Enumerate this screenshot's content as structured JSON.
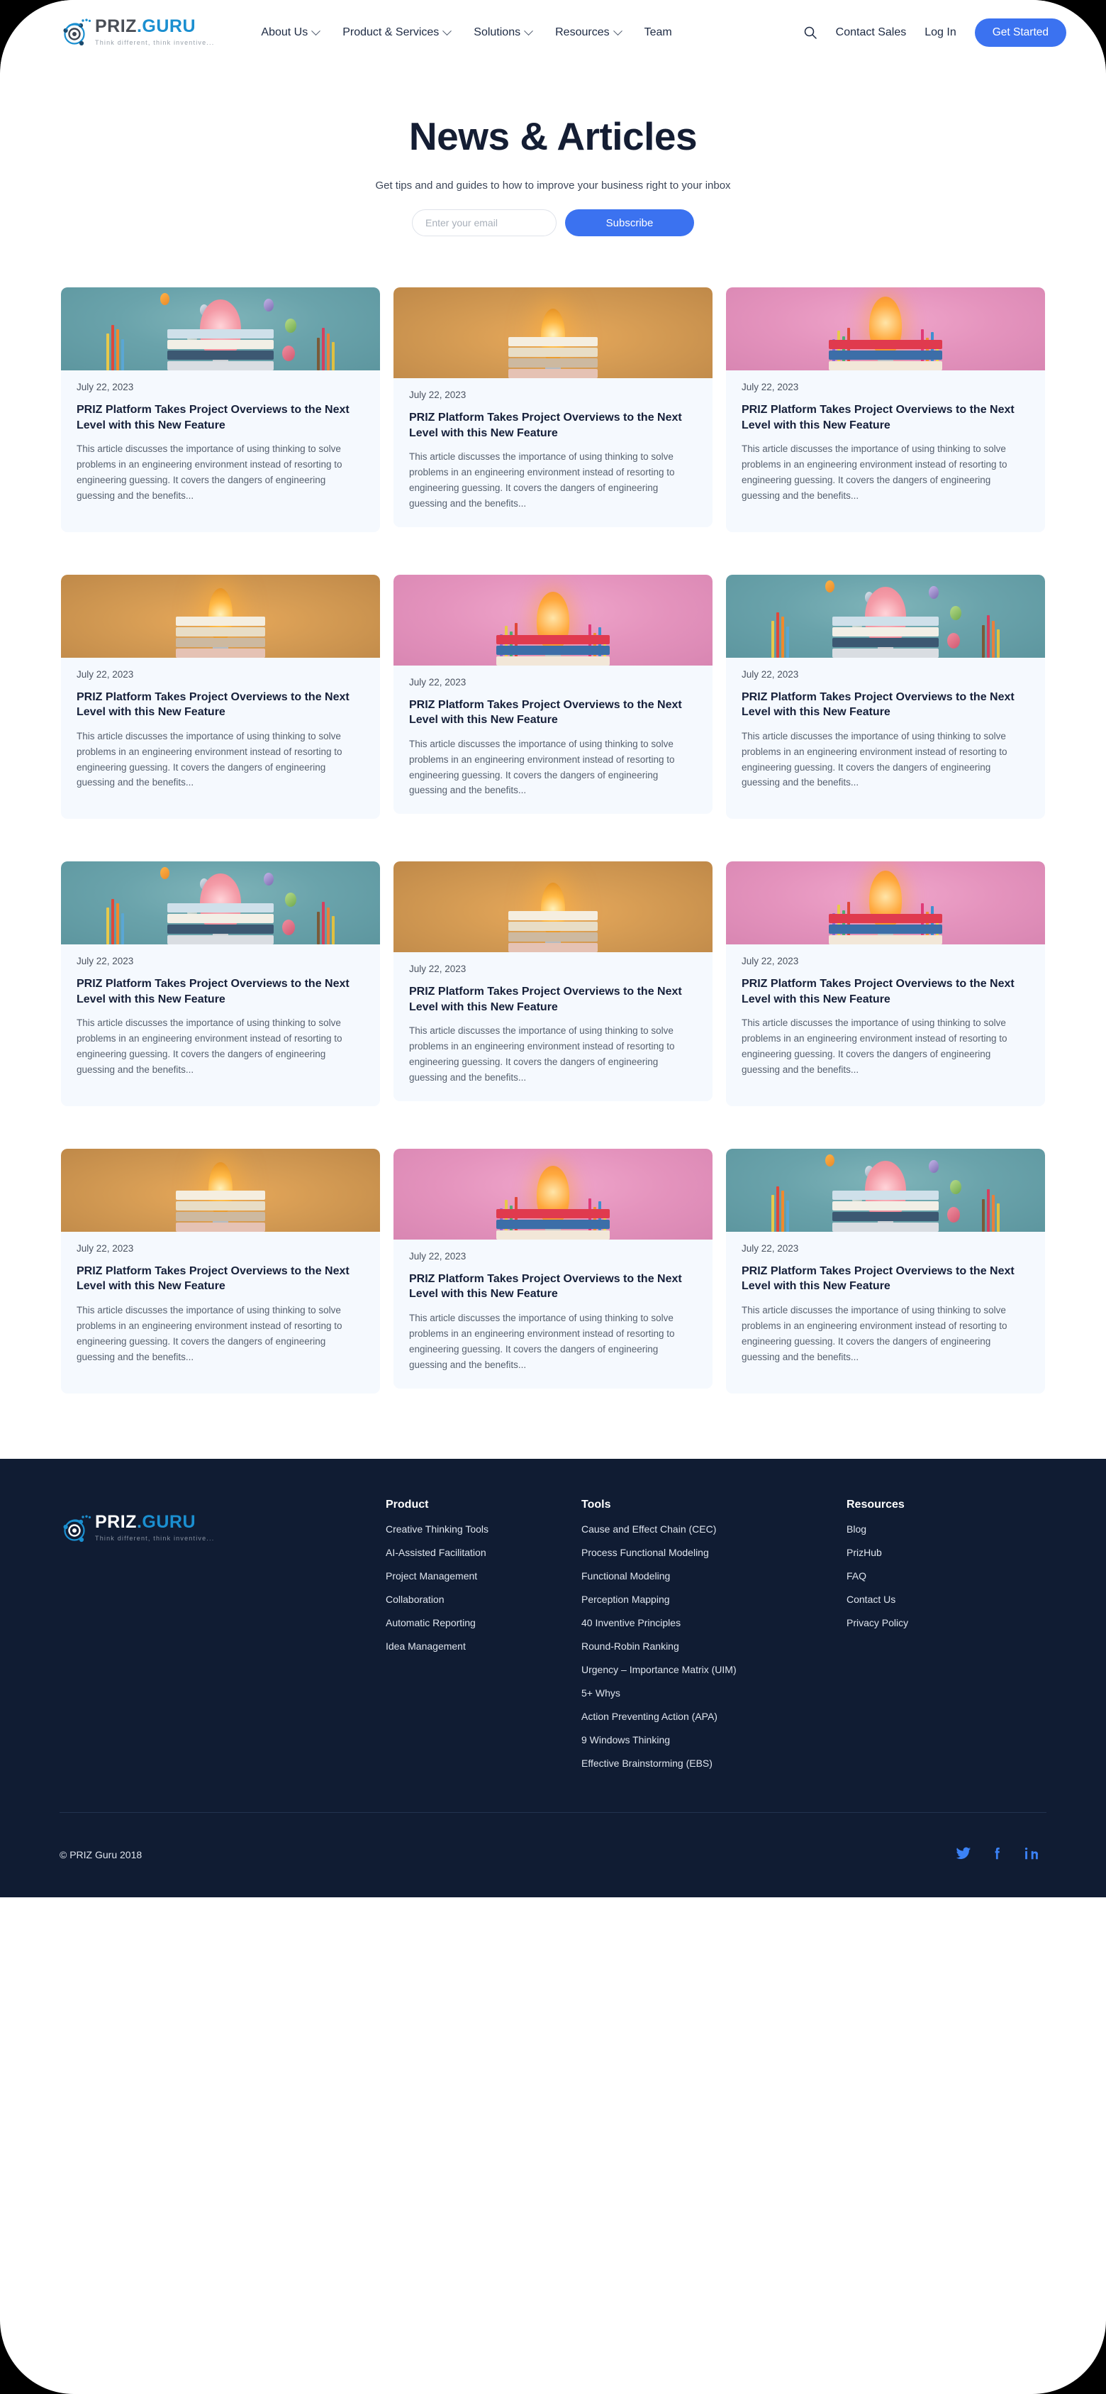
{
  "brand": {
    "name_priz": "PRIZ",
    "name_dot": ".",
    "name_guru": "GURU",
    "tagline": "Think different, think inventive..."
  },
  "header": {
    "nav": [
      {
        "label": "About Us",
        "has_caret": true
      },
      {
        "label": "Product & Services",
        "has_caret": true
      },
      {
        "label": "Solutions",
        "has_caret": true
      },
      {
        "label": "Resources",
        "has_caret": true
      },
      {
        "label": "Team",
        "has_caret": false
      }
    ],
    "search_icon": "search-icon",
    "contact_sales": "Contact Sales",
    "log_in": "Log In",
    "get_started": "Get Started",
    "accent_color": "#3b72f0"
  },
  "hero": {
    "title": "News & Articles",
    "subtitle": "Get tips and and guides to how to improve your business right to your inbox",
    "email_placeholder": "Enter your email",
    "email_value": "",
    "subscribe_label": "Subscribe"
  },
  "articles": [
    {
      "date": "July 22, 2023",
      "title": "PRIZ Platform Takes Project Overviews to the Next Level with this New Feature",
      "excerpt": "This article discusses the importance of using thinking to solve problems in an engineering environment instead of resorting to engineering guessing. It covers the dangers of engineering guessing and the benefits...",
      "image": "teal-brain-bulb-books-pencils"
    },
    {
      "date": "July 22, 2023",
      "title": "PRIZ Platform Takes Project Overviews to the Next Level with this New Feature",
      "excerpt": "This article discusses the importance of using thinking to solve problems in an engineering environment instead of resorting to engineering guessing. It covers the dangers of engineering guessing and the benefits...",
      "image": "amber-bulb-books"
    },
    {
      "date": "July 22, 2023",
      "title": "PRIZ Platform Takes Project Overviews to the Next Level with this New Feature",
      "excerpt": "This article discusses the importance of using thinking to solve problems in an engineering environment instead of resorting to engineering guessing. It covers the dangers of engineering guessing and the benefits...",
      "image": "pink-bulb-pencils-books"
    },
    {
      "date": "July 22, 2023",
      "title": "PRIZ Platform Takes Project Overviews to the Next Level with this New Feature",
      "excerpt": "This article discusses the importance of using thinking to solve problems in an engineering environment instead of resorting to engineering guessing. It covers the dangers of engineering guessing and the benefits...",
      "image": "amber-bulb-books"
    },
    {
      "date": "July 22, 2023",
      "title": "PRIZ Platform Takes Project Overviews to the Next Level with this New Feature",
      "excerpt": "This article discusses the importance of using thinking to solve problems in an engineering environment instead of resorting to engineering guessing. It covers the dangers of engineering guessing and the benefits...",
      "image": "pink-bulb-pencils-books"
    },
    {
      "date": "July 22, 2023",
      "title": "PRIZ Platform Takes Project Overviews to the Next Level with this New Feature",
      "excerpt": "This article discusses the importance of using thinking to solve problems in an engineering environment instead of resorting to engineering guessing. It covers the dangers of engineering guessing and the benefits...",
      "image": "teal-brain-bulb-books-pencils"
    },
    {
      "date": "July 22, 2023",
      "title": "PRIZ Platform Takes Project Overviews to the Next Level with this New Feature",
      "excerpt": "This article discusses the importance of using thinking to solve problems in an engineering environment instead of resorting to engineering guessing. It covers the dangers of engineering guessing and the benefits...",
      "image": "teal-brain-bulb-books-pencils"
    },
    {
      "date": "July 22, 2023",
      "title": "PRIZ Platform Takes Project Overviews to the Next Level with this New Feature",
      "excerpt": "This article discusses the importance of using thinking to solve problems in an engineering environment instead of resorting to engineering guessing. It covers the dangers of engineering guessing and the benefits...",
      "image": "amber-bulb-books"
    },
    {
      "date": "July 22, 2023",
      "title": "PRIZ Platform Takes Project Overviews to the Next Level with this New Feature",
      "excerpt": "This article discusses the importance of using thinking to solve problems in an engineering environment instead of resorting to engineering guessing. It covers the dangers of engineering guessing and the benefits...",
      "image": "pink-bulb-pencils-books"
    },
    {
      "date": "July 22, 2023",
      "title": "PRIZ Platform Takes Project Overviews to the Next Level with this New Feature",
      "excerpt": "This article discusses the importance of using thinking to solve problems in an engineering environment instead of resorting to engineering guessing. It covers the dangers of engineering guessing and the benefits...",
      "image": "amber-bulb-books"
    },
    {
      "date": "July 22, 2023",
      "title": "PRIZ Platform Takes Project Overviews to the Next Level with this New Feature",
      "excerpt": "This article discusses the importance of using thinking to solve problems in an engineering environment instead of resorting to engineering guessing. It covers the dangers of engineering guessing and the benefits...",
      "image": "pink-bulb-pencils-books"
    },
    {
      "date": "July 22, 2023",
      "title": "PRIZ Platform Takes Project Overviews to the Next Level with this New Feature",
      "excerpt": "This article discusses the importance of using thinking to solve problems in an engineering environment instead of resorting to engineering guessing. It covers the dangers of engineering guessing and the benefits...",
      "image": "teal-brain-bulb-books-pencils"
    }
  ],
  "footer": {
    "columns": [
      {
        "heading": "Product",
        "links": [
          "Creative Thinking Tools",
          "AI-Assisted Facilitation",
          "Project Management",
          "Collaboration",
          "Automatic Reporting",
          "Idea Management"
        ]
      },
      {
        "heading": "Tools",
        "links": [
          "Cause and Effect Chain (CEC)",
          "Process Functional Modeling",
          "Functional Modeling",
          "Perception Mapping",
          "40 Inventive Principles",
          "Round-Robin Ranking",
          "Urgency – Importance Matrix (UIM)",
          "5+ Whys",
          "Action Preventing Action (APA)",
          "9 Windows Thinking",
          "Effective Brainstorming (EBS)"
        ]
      },
      {
        "heading": "Resources",
        "links": [
          "Blog",
          "PrizHub",
          "FAQ",
          "Contact Us",
          "Privacy Policy"
        ]
      }
    ],
    "copyright": "© PRIZ Guru 2018",
    "socials": [
      "twitter-icon",
      "facebook-icon",
      "linkedin-icon"
    ],
    "background_color": "#101c33",
    "social_color": "#3b82f6"
  }
}
